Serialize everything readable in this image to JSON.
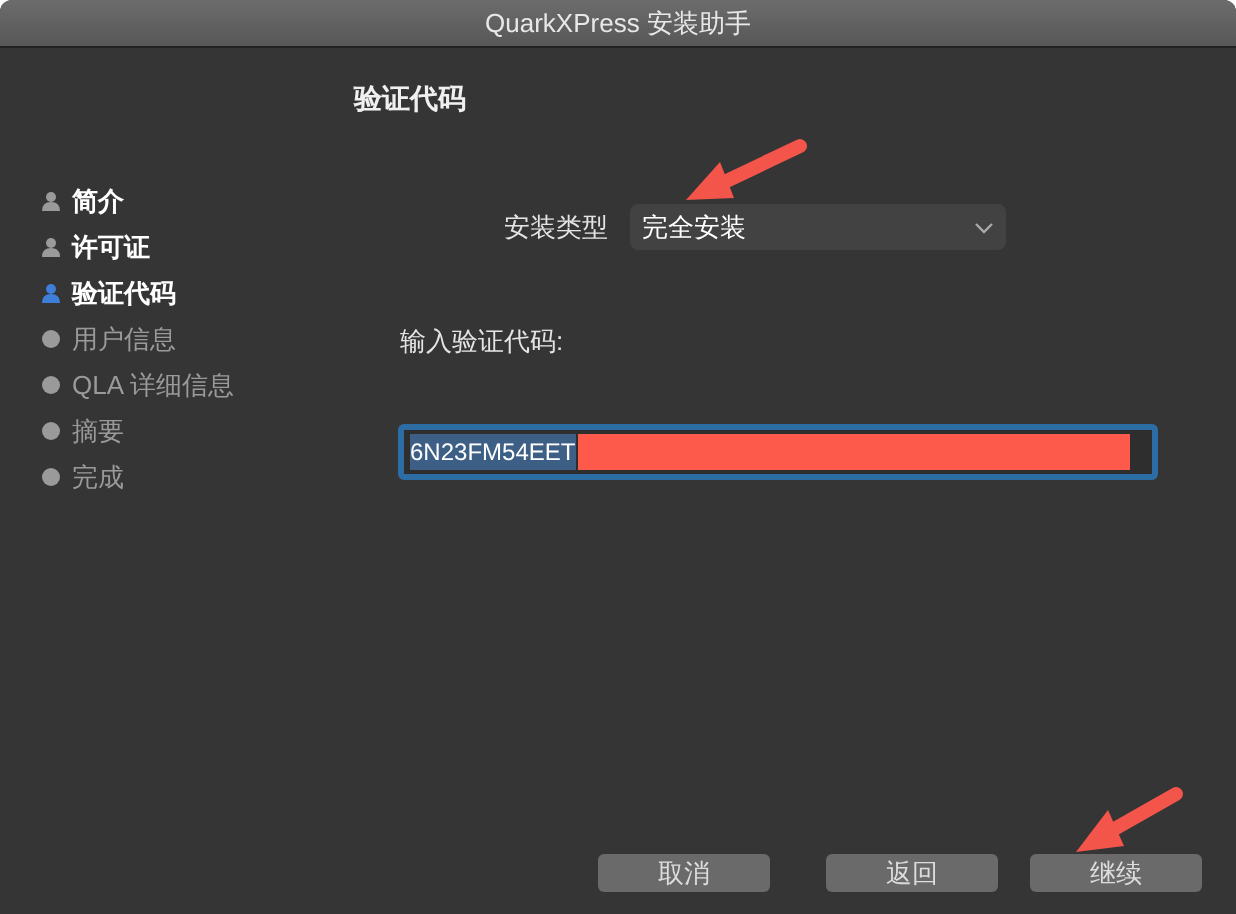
{
  "window": {
    "title": "QuarkXPress 安装助手"
  },
  "heading": "验证代码",
  "steps": [
    {
      "label": "简介",
      "completed": true,
      "selected": false
    },
    {
      "label": "许可证",
      "completed": true,
      "selected": false
    },
    {
      "label": "验证代码",
      "selected": true
    },
    {
      "label": "用户信息",
      "completed": false,
      "selected": false
    },
    {
      "label": "QLA 详细信息",
      "completed": false,
      "selected": false
    },
    {
      "label": "摘要",
      "completed": false,
      "selected": false
    },
    {
      "label": "完成",
      "completed": false,
      "selected": false
    }
  ],
  "install_type": {
    "label": "安装类型",
    "value": "完全安装"
  },
  "code_field": {
    "label": "输入验证代码:",
    "value": "6N23FM54EET"
  },
  "buttons": [
    {
      "label": "取消"
    },
    {
      "label": "返回"
    },
    {
      "label": "继续"
    }
  ]
}
